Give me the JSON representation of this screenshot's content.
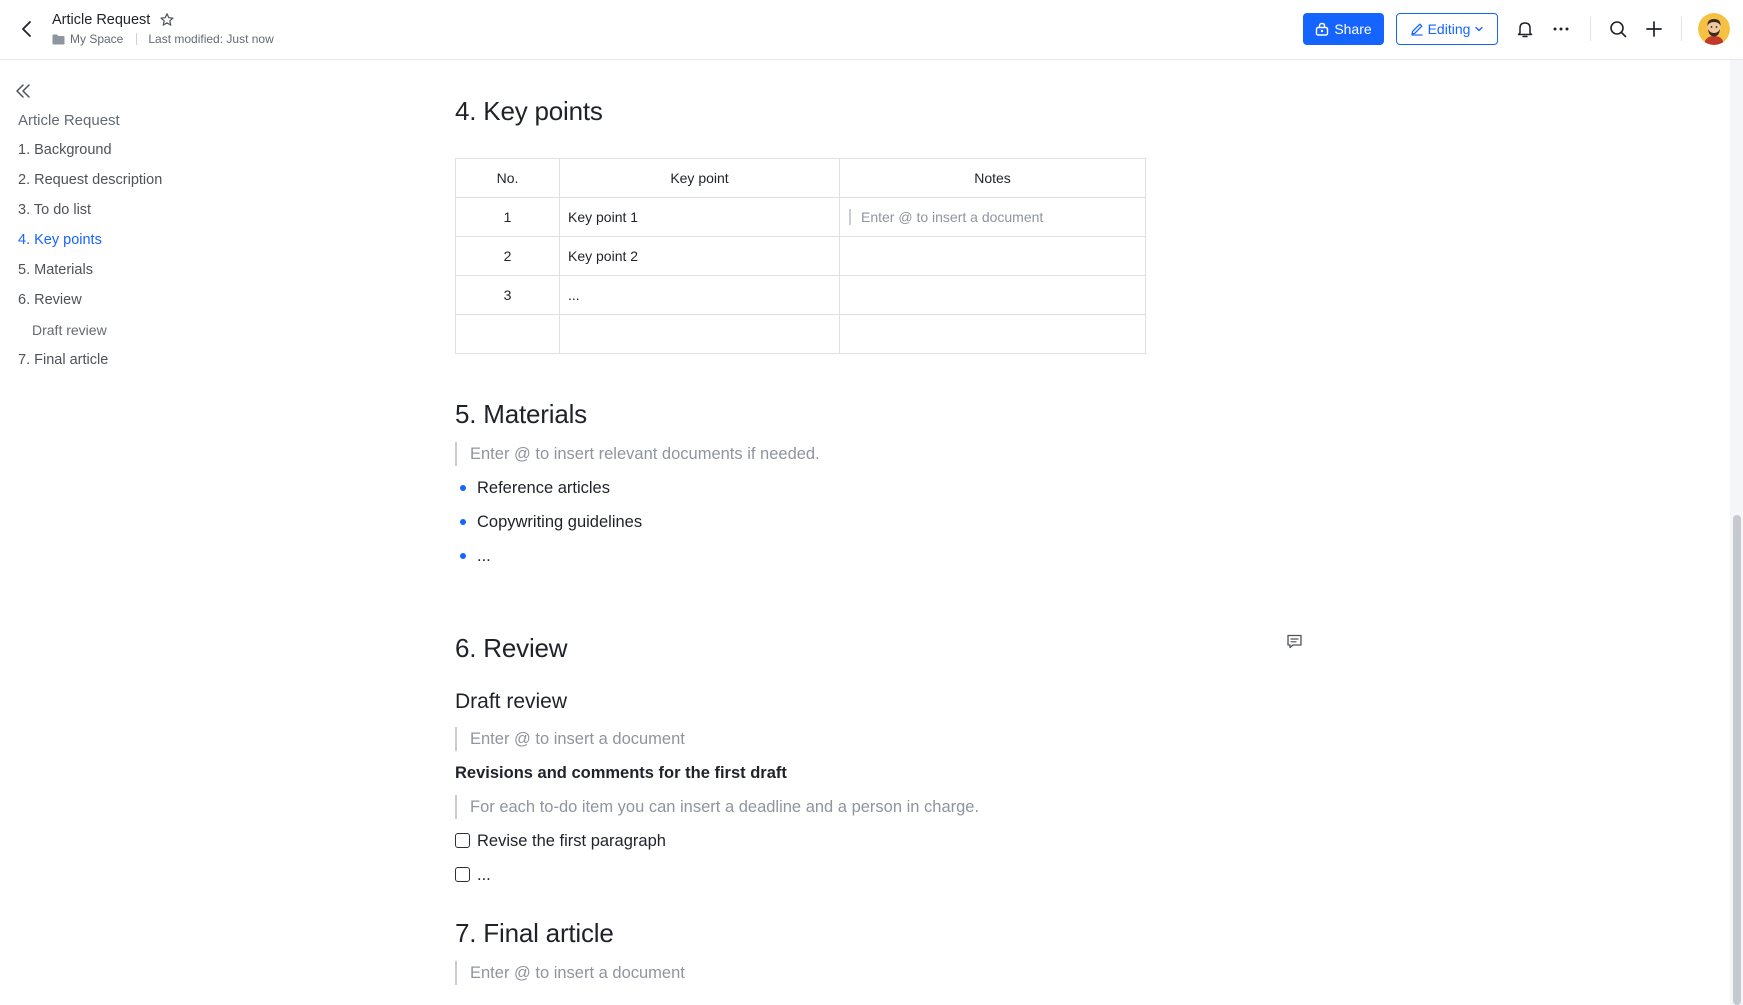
{
  "header": {
    "title": "Article Request",
    "location": "My Space",
    "last_modified": "Last modified: Just now",
    "share_label": "Share",
    "editing_label": "Editing"
  },
  "outline": {
    "title": "Article Request",
    "items": [
      {
        "label": "1. Background",
        "active": false,
        "sub": false
      },
      {
        "label": "2. Request description",
        "active": false,
        "sub": false
      },
      {
        "label": "3. To do list",
        "active": false,
        "sub": false
      },
      {
        "label": "4. Key points",
        "active": true,
        "sub": false
      },
      {
        "label": "5. Materials",
        "active": false,
        "sub": false
      },
      {
        "label": "6. Review",
        "active": false,
        "sub": false
      },
      {
        "label": "Draft review",
        "active": false,
        "sub": true
      },
      {
        "label": "7. Final article",
        "active": false,
        "sub": false
      }
    ]
  },
  "document": {
    "key_points": {
      "heading": "4.  Key points",
      "table": {
        "headers": [
          "No.",
          "Key point",
          "Notes"
        ],
        "rows": [
          [
            "1",
            "Key point 1",
            "Enter @ to insert a document"
          ],
          [
            "2",
            "Key point 2",
            ""
          ],
          [
            "3",
            "...",
            ""
          ],
          [
            "",
            "",
            ""
          ]
        ]
      }
    },
    "materials": {
      "heading": "5. Materials",
      "placeholder": "Enter @ to insert relevant documents if needed.",
      "bullets": [
        "Reference articles",
        "Copywriting guidelines",
        "..."
      ]
    },
    "review": {
      "heading": "6. Review",
      "draft_heading": "Draft review",
      "draft_placeholder": "Enter @ to insert a document",
      "revisions_title": "Revisions and comments for the first draft",
      "revisions_placeholder": "For each to-do item you can insert a deadline and a person in charge.",
      "todos": [
        {
          "label": "Revise the first paragraph",
          "checked": false
        },
        {
          "label": "...",
          "checked": false
        }
      ]
    },
    "final": {
      "heading": "7. Final article",
      "placeholder": "Enter @ to insert a document"
    }
  },
  "colors": {
    "accent": "#1664ff",
    "text": "#1f2329",
    "muted": "#8f959e"
  }
}
